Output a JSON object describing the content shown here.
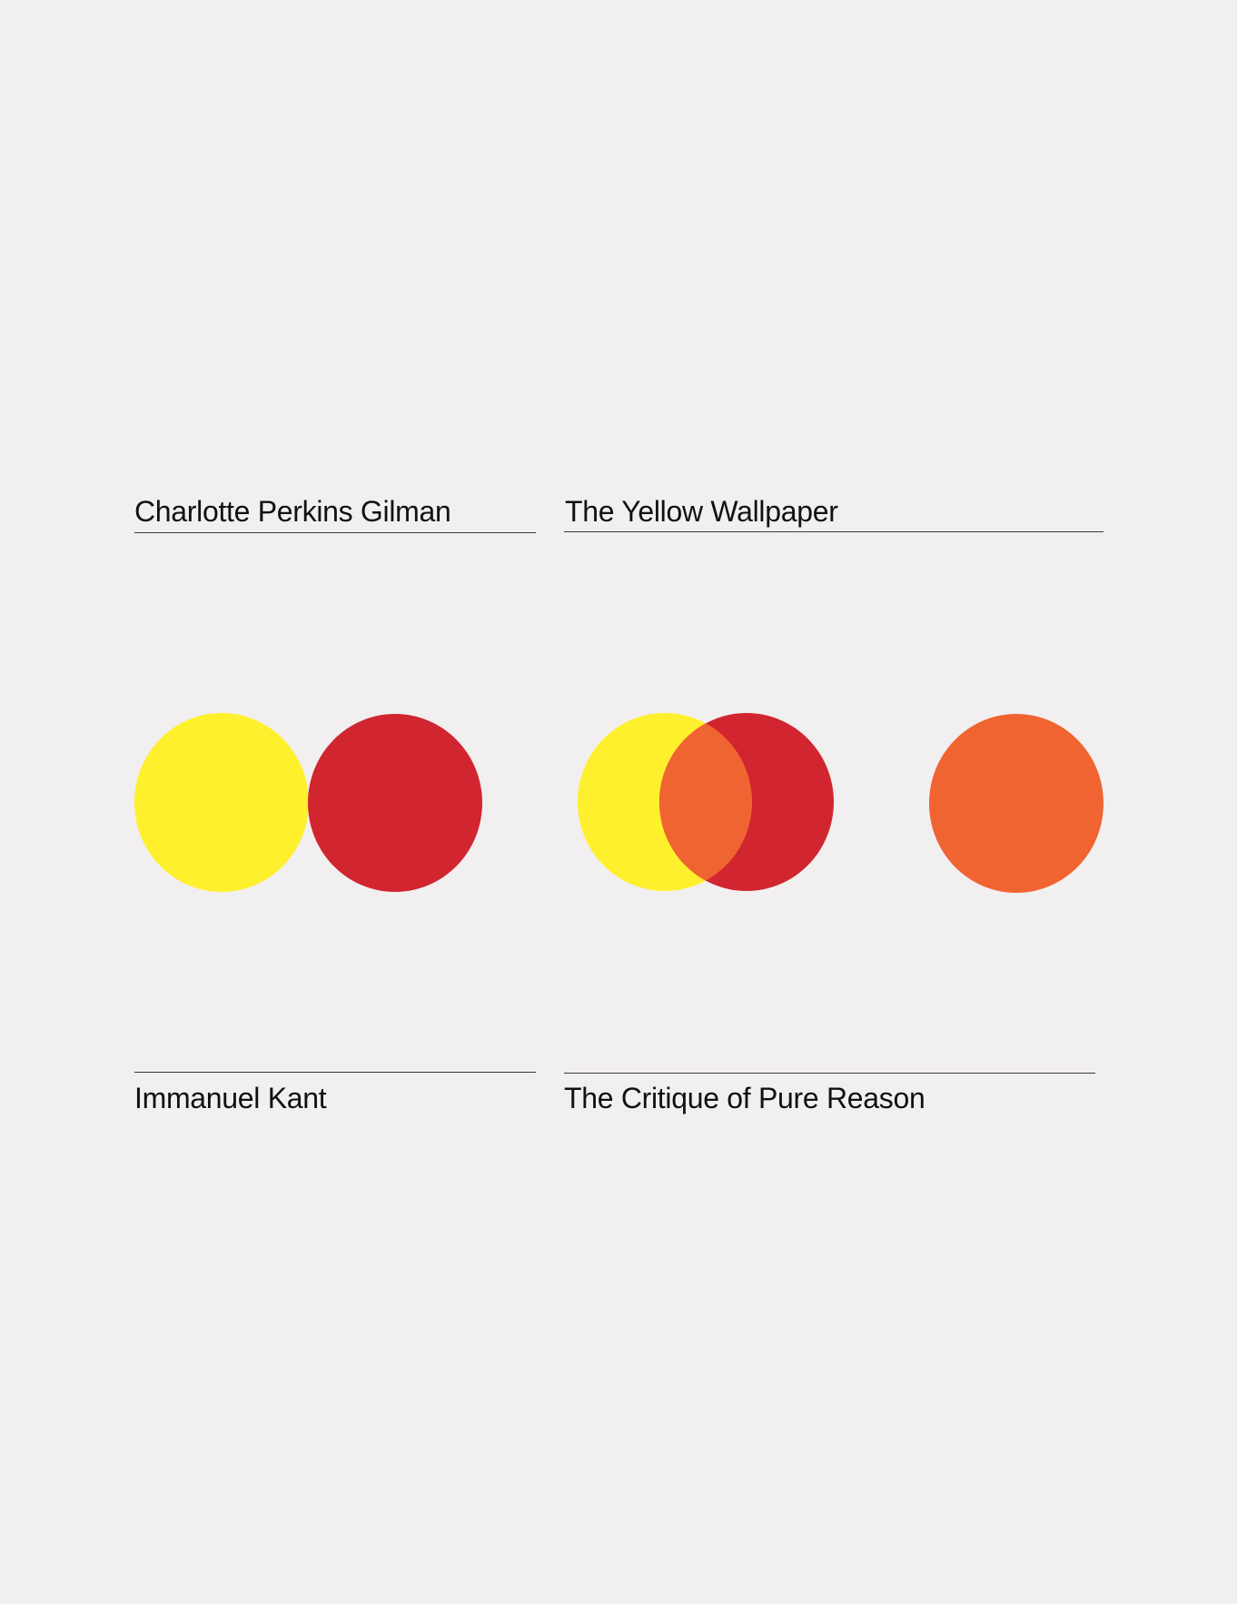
{
  "top": {
    "author": "Charlotte Perkins Gilman",
    "title": "The Yellow Wallpaper"
  },
  "bottom": {
    "author": "Immanuel Kant",
    "title": "The Critique of Pure Reason"
  },
  "colors": {
    "background": "#f2eff0",
    "yellow": "#fff02d",
    "red": "#d12530",
    "orange": "#f06432",
    "text": "#111111",
    "rule": "#3a3a3a"
  }
}
